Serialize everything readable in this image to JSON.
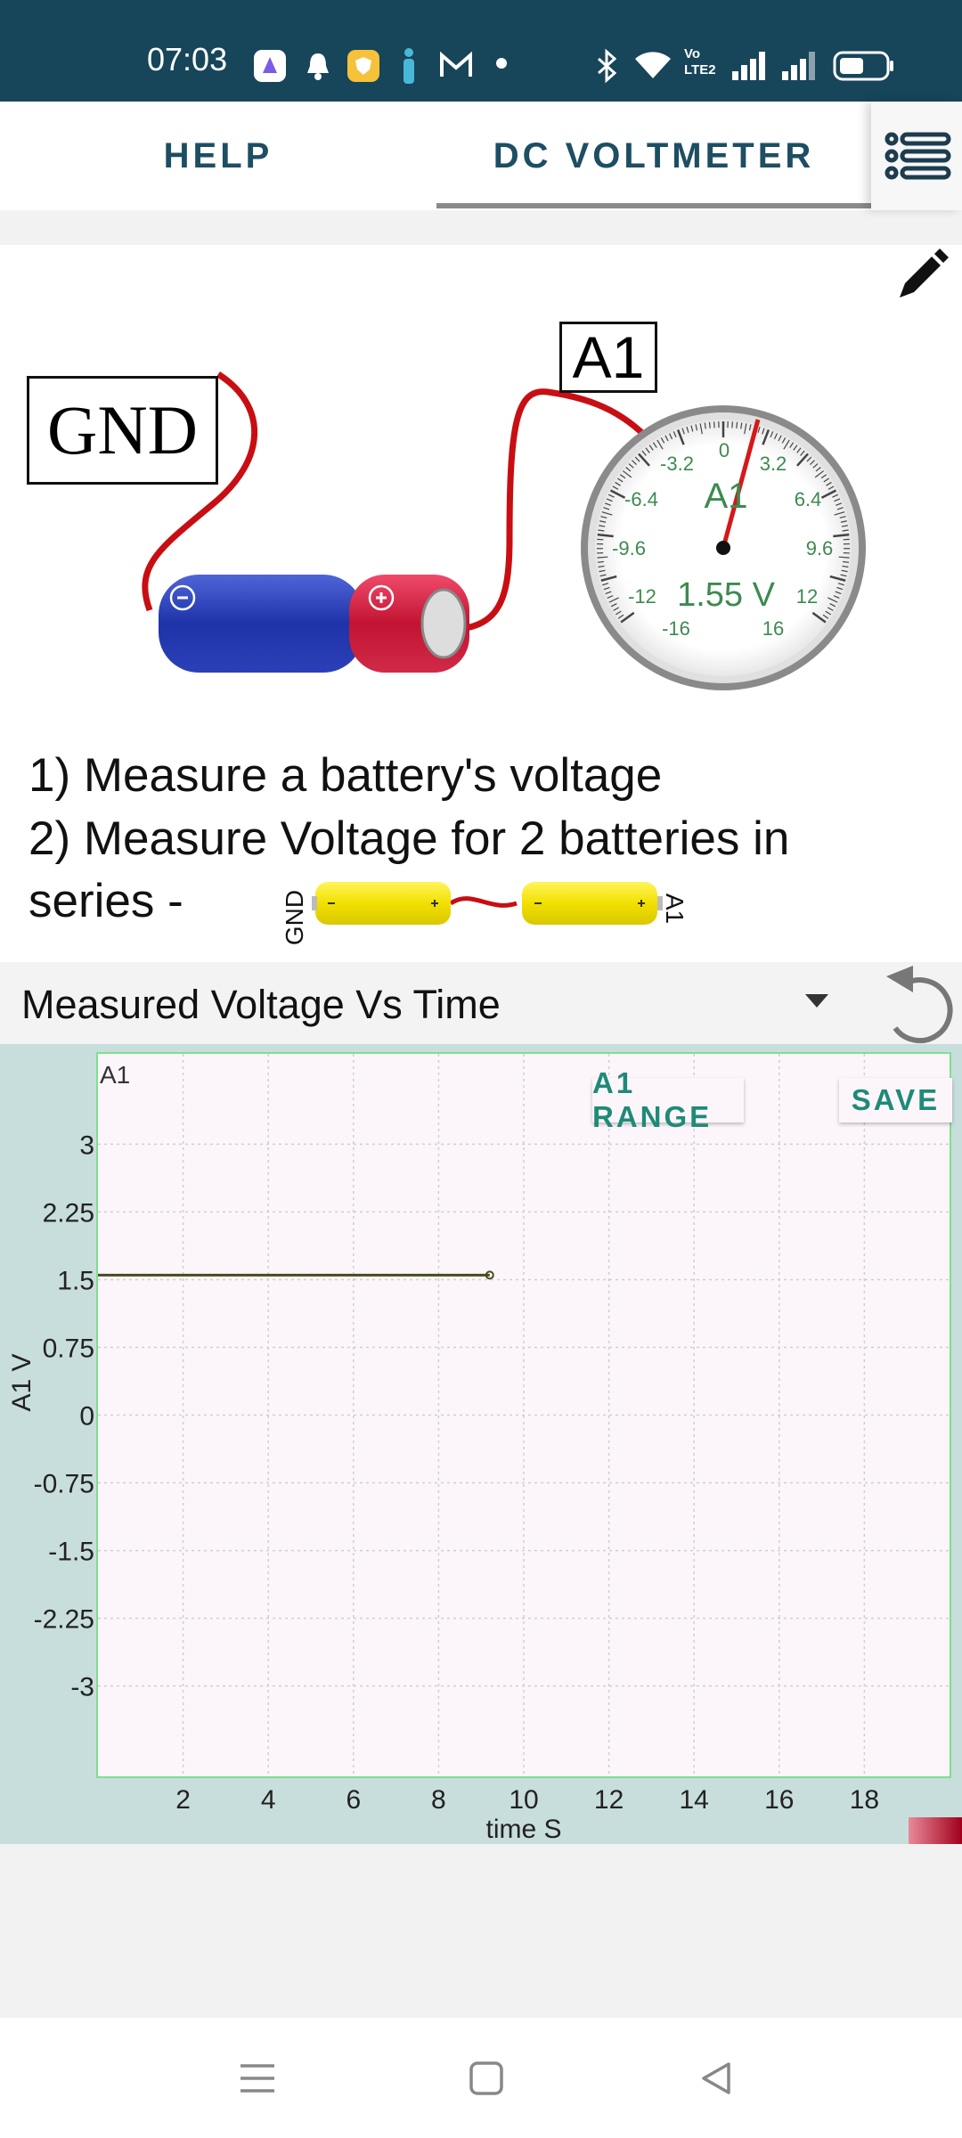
{
  "status_bar": {
    "time": "07:03",
    "icons": [
      "photos-icon",
      "bell-icon",
      "shield-icon",
      "person-icon",
      "gmail-icon",
      "dot-icon",
      "bluetooth-icon",
      "wifi-icon",
      "volte-icon",
      "signal-icon",
      "signal2-icon",
      "battery-icon"
    ],
    "volte_text": "Vo LTE2"
  },
  "tabs": {
    "help": "HELP",
    "dc_voltmeter": "DC VOLTMETER"
  },
  "illustration": {
    "gnd_label": "GND",
    "a1_label": "A1",
    "meter_channel": "A1",
    "meter_reading": "1.55 V",
    "meter_ticks": [
      "0",
      "-3.2",
      "3.2",
      "-6.4",
      "6.4",
      "-9.6",
      "9.6",
      "-12",
      "12",
      "-16",
      "16"
    ],
    "small_gnd": "GND",
    "small_a1": "A1"
  },
  "instructions": {
    "line1": "1) Measure a battery's voltage",
    "line2": "2) Measure Voltage for 2 batteries in",
    "line3": "series -"
  },
  "chart_header": {
    "title": "Measured Voltage Vs Time"
  },
  "buttons": {
    "range": "A1 RANGE",
    "save": "SAVE"
  },
  "chart_data": {
    "type": "line",
    "series": [
      {
        "name": "A1",
        "x": [
          0,
          9.2
        ],
        "y": [
          1.55,
          1.55
        ],
        "color": "#4a4a1e"
      }
    ],
    "series_label": "A1",
    "xlabel": "time S",
    "ylabel": "A1 V",
    "xlim": [
      0,
      20
    ],
    "ylim": [
      -4,
      4
    ],
    "xticks": [
      2,
      4,
      6,
      8,
      10,
      12,
      14,
      16,
      18
    ],
    "yticks": [
      3,
      2.25,
      1.5,
      0.75,
      0,
      -0.75,
      -1.5,
      -2.25,
      -3
    ],
    "xtick_labels": [
      "2",
      "4",
      "6",
      "8",
      "10",
      "12",
      "14",
      "16",
      "18"
    ],
    "ytick_labels": [
      "3",
      "2.25",
      "1.5",
      "0.75",
      "0",
      "-0.75",
      "-1.5",
      "-2.25",
      "-3"
    ],
    "grid": true
  }
}
